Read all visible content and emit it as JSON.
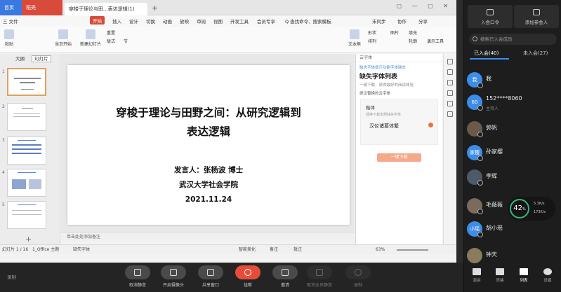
{
  "wps": {
    "tabs": {
      "home": "首页",
      "draw": "稻壳",
      "doc": "穿梭于理论与田...表达逻辑(1)"
    },
    "menus": [
      "三 文件",
      "开始",
      "插入",
      "设计",
      "切换",
      "动画",
      "放映",
      "审阅",
      "视图",
      "开发工具",
      "会员专享",
      "Q 查找命令、搜索模板",
      "未同步",
      "协作",
      "分享"
    ],
    "ribbon": [
      "粘贴",
      "当页开始",
      "新建幻灯片",
      "版式",
      "节",
      "重置",
      "文本框",
      "形状",
      "排列",
      "图片",
      "填充",
      "轮廓",
      "演示工具"
    ],
    "left_tabs": [
      "大纲",
      "幻灯片"
    ],
    "thumb_numbers": [
      "1",
      "2",
      "3",
      "4",
      "5"
    ],
    "slide": {
      "title_line1": "穿梭于理论与田野之间：从研究逻辑到",
      "title_line2": "表达逻辑",
      "speaker": "发言人：张杨波 博士",
      "institution": "武汉大学社会学院",
      "date": "2021.11.24"
    },
    "notes_placeholder": "单击此处添加备注",
    "cloud": {
      "header": "云字体",
      "link": "缺失字体提示功能字体缺失",
      "title": "缺失字体列表",
      "subtitle": "一键下载，获得最好的阅读体验",
      "label": "提议替换的云字体",
      "font_group": "楷体",
      "font_hint": "替换下载全部缺失字体",
      "font_name": "汉仪诸葛体繁",
      "button": "一键下载"
    },
    "status": {
      "slide": "幻灯片 1 / 16",
      "theme": "1_Office 主题",
      "missing": "缺失字体",
      "beautify": "智能美化",
      "notes": "备注",
      "comments": "批注",
      "zoom": "63%"
    }
  },
  "meeting": {
    "recording": "录制",
    "buttons": [
      "取消静音",
      "开启摄像头",
      "共享窗口",
      "挂断",
      "邀请",
      "取消全员静音",
      "录制"
    ]
  },
  "sidebar": {
    "invite_code": "入会口令",
    "add_participant": "添加参会人",
    "search_placeholder": "搜索已入会成员",
    "tab_joined": "已入会(40)",
    "tab_not_joined": "未入会(27)",
    "members": [
      {
        "avatar": "我",
        "name": "我",
        "role": ""
      },
      {
        "avatar": "60",
        "name": "152****8060",
        "role": "主持人"
      },
      {
        "avatar": "",
        "name": "郭帆",
        "role": ""
      },
      {
        "avatar": "家樱",
        "name": "孙家樱",
        "role": ""
      },
      {
        "avatar": "",
        "name": "李辉",
        "role": ""
      },
      {
        "avatar": "",
        "name": "毛薇薇",
        "role": ""
      },
      {
        "avatar": "小瑶",
        "name": "胡小瑶",
        "role": ""
      },
      {
        "avatar": "",
        "name": "钟天",
        "role": ""
      }
    ],
    "network": {
      "value": "42",
      "unit": "%",
      "up": "5.3K/s",
      "down": "173K/s"
    },
    "footer": [
      "演讲",
      "宫格",
      "列表",
      "设置"
    ]
  },
  "colors": {
    "accent": "#3b8ef5",
    "hangup": "#e54d3a",
    "wps_red": "#d84b3a"
  }
}
